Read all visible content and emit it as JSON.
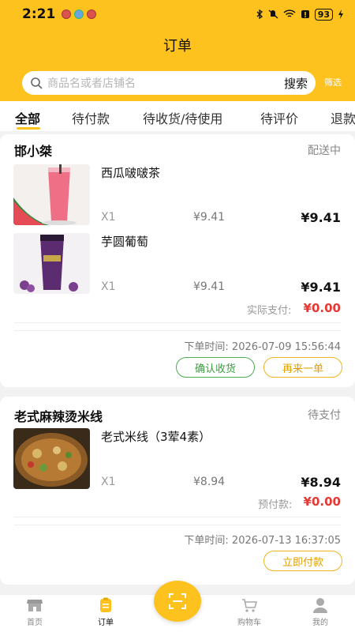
{
  "status": {
    "time": "2:21",
    "battery": "93"
  },
  "header": {
    "title": "订单",
    "search_placeholder": "商品名或者店铺名",
    "search_button": "搜索",
    "filter_label": "筛选"
  },
  "tabs": [
    {
      "label": "全部"
    },
    {
      "label": "待付款"
    },
    {
      "label": "待收货/待使用"
    },
    {
      "label": "待评价"
    },
    {
      "label": "退款"
    }
  ],
  "orders": [
    {
      "shop": "邯小桀",
      "status": "配送中",
      "items": [
        {
          "name": "西瓜啵啵茶",
          "qty": "X1",
          "unit_price": "¥9.41",
          "total": "¥9.41"
        },
        {
          "name": "芋圆葡萄",
          "qty": "X1",
          "unit_price": "¥9.41",
          "total": "¥9.41"
        }
      ],
      "pay_label": "实际支付:",
      "pay_value": "¥0.00",
      "time_label": "下单时间: 2026-07-09 15:56:44",
      "buttons": [
        "确认收货",
        "再来一单"
      ]
    },
    {
      "shop": "老式麻辣烫米线",
      "status": "待支付",
      "items": [
        {
          "name": "老式米线（3荤4素）",
          "qty": "X1",
          "unit_price": "¥8.94",
          "total": "¥8.94"
        }
      ],
      "pay_label": "预付款:",
      "pay_value": "¥0.00",
      "time_label": "下单时间: 2026-07-13 16:37:05",
      "buttons": [
        "立即付款"
      ]
    }
  ],
  "nav": [
    {
      "label": "首页",
      "icon": "shop-icon"
    },
    {
      "label": "订单",
      "icon": "clipboard-icon"
    },
    {
      "label": "购物车",
      "icon": "cart-icon"
    },
    {
      "label": "我的",
      "icon": "user-icon"
    }
  ],
  "colors": {
    "brand": "#fdc21e",
    "price_red": "#e53935",
    "confirm_green": "#4caf50"
  }
}
